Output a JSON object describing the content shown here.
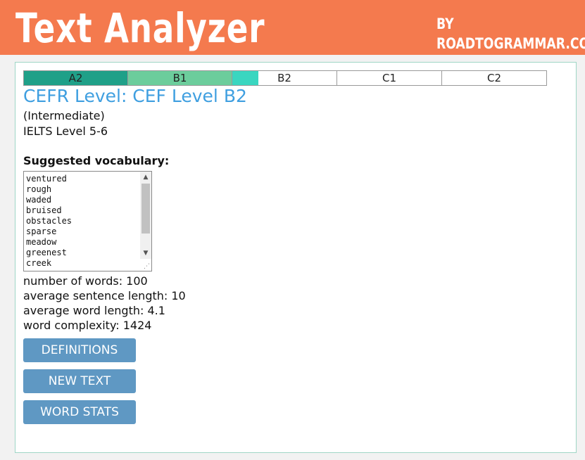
{
  "header": {
    "logo_text": "Text Analyzer",
    "by_label": "BY",
    "site": "ROADTOGRAMMAR.COM",
    "bg_color": "#f47a4e"
  },
  "levels": [
    {
      "label": "A2",
      "color": "#1fa088",
      "fill": 1.0
    },
    {
      "label": "B1",
      "color": "#6ccd9c",
      "fill": 1.0
    },
    {
      "label": "B2",
      "color": "#3ad6c0",
      "fill": 0.25
    },
    {
      "label": "C1",
      "color": "#ffffff",
      "fill": 0.0
    },
    {
      "label": "C2",
      "color": "#ffffff",
      "fill": 0.0
    }
  ],
  "result": {
    "title": "CEFR Level: CEF Level B2",
    "subtitle": "(Intermediate)",
    "ielts": "IELTS Level 5-6"
  },
  "vocabulary": {
    "label": "Suggested vocabulary:",
    "words": [
      "ventured",
      "rough",
      "waded",
      "bruised",
      "obstacles",
      "sparse",
      "meadow",
      "greenest",
      "creek"
    ]
  },
  "stats": {
    "words": "number of words: 100",
    "sentence_length": "average sentence length: 10",
    "word_length": "average word length: 4.1",
    "complexity": "word complexity: 1424"
  },
  "buttons": {
    "definitions": "DEFINITIONS",
    "new_text": "NEW TEXT",
    "word_stats": "WORD STATS"
  }
}
